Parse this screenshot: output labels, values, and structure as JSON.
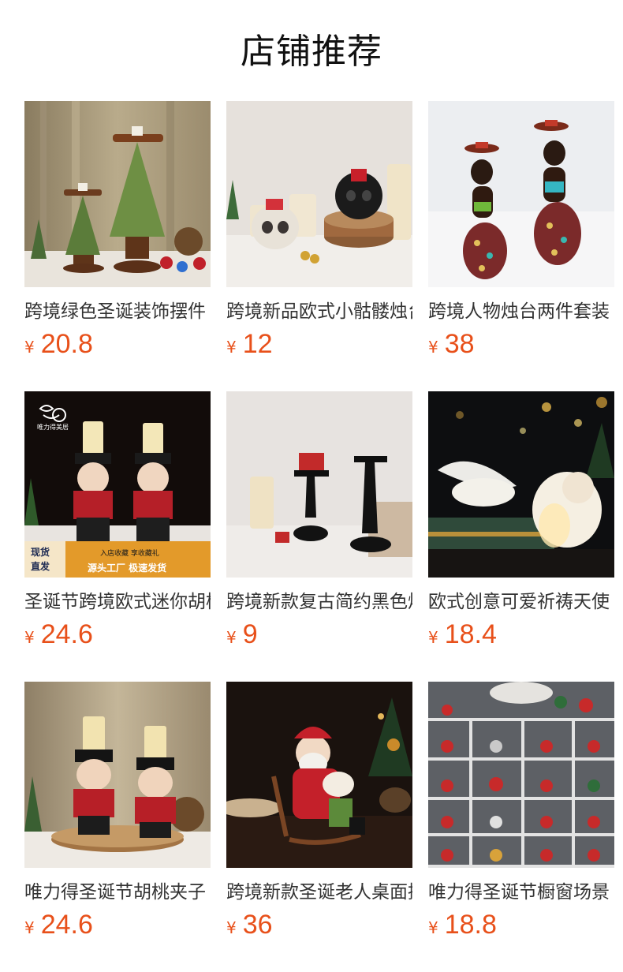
{
  "title": "店铺推荐",
  "currency_symbol": "¥",
  "accent_color": "#e8501a",
  "products": [
    {
      "name": "跨境绿色圣诞装饰摆件",
      "price": "20.8",
      "image": "green-christmas-tree-candle-holders"
    },
    {
      "name": "跨境新品欧式小骷髅烛台",
      "price": "12",
      "image": "skull-candle-holders"
    },
    {
      "name": "跨境人物烛台两件套装",
      "price": "38",
      "image": "african-figure-candle-holders"
    },
    {
      "name": "圣诞节跨境欧式迷你胡桃夹子",
      "price": "24.6",
      "image": "nutcracker-candle-holders"
    },
    {
      "name": "跨境新款复古简约黑色烛台",
      "price": "9",
      "image": "black-pillar-candlesticks"
    },
    {
      "name": "欧式创意可爱祈祷天使",
      "price": "18.4",
      "image": "praying-angel-figurines"
    },
    {
      "name": "唯力得圣诞节胡桃夹子",
      "price": "24.6",
      "image": "nutcracker-pair-on-wood"
    },
    {
      "name": "跨境新款圣诞老人桌面摆件",
      "price": "36",
      "image": "santa-rocking-chair"
    },
    {
      "name": "唯力得圣诞节橱窗场景",
      "price": "18.8",
      "image": "santa-figurines-shelf"
    }
  ],
  "overlay_text": {
    "brand": "唯力得美居",
    "badge_line1": "现货",
    "badge_line2": "直发",
    "banner_line1": "入店收藏  享收藏礼",
    "banner_line2": "源头工厂  极速发货"
  }
}
